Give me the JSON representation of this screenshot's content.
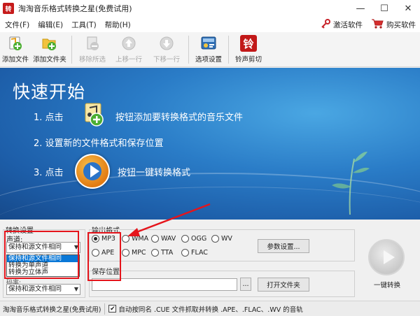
{
  "window": {
    "app_icon_text": "转",
    "title": "淘淘音乐格式转换之星(免费试用)",
    "controls": {
      "minimize": "—",
      "maximize": "☐",
      "close": "✕"
    }
  },
  "menu": {
    "items": [
      "文件(F)",
      "编辑(E)",
      "工具(T)",
      "帮助(H)"
    ],
    "activate": "激活软件",
    "buy": "购买软件"
  },
  "toolbar": {
    "buttons": [
      {
        "label": "添加文件",
        "icon": "add-file-icon",
        "enabled": true
      },
      {
        "label": "添加文件夹",
        "icon": "add-folder-icon",
        "enabled": true
      },
      {
        "label": "移除所选",
        "icon": "remove-icon",
        "enabled": false
      },
      {
        "label": "上移一行",
        "icon": "move-up-icon",
        "enabled": false
      },
      {
        "label": "下移一行",
        "icon": "move-down-icon",
        "enabled": false
      },
      {
        "label": "选项设置",
        "icon": "options-icon",
        "enabled": true
      },
      {
        "label": "铃声剪切",
        "icon": "ringtone-icon",
        "enabled": true
      }
    ],
    "ringtone_glyph": "铃"
  },
  "banner": {
    "title": "快速开始",
    "step1_prefix": "1. 点击",
    "step1_suffix": "按钮添加要转换格式的音乐文件",
    "step2": "2. 设置新的文件格式和保存位置",
    "step3_prefix": "3. 点击",
    "step3_suffix": "按钮一键转换格式"
  },
  "convert_settings": {
    "group_label": "转换设置",
    "channel_label": "声道:",
    "channel_value": "保持和源文件相同",
    "channel_options": [
      "保持和源文件相同",
      "转换为单声道",
      "转换为立体声"
    ],
    "second_label": "码率:",
    "second_value": "保持和源文件相同"
  },
  "output_format": {
    "group_label": "输出格式",
    "formats_row1": [
      "MP3",
      "WMA",
      "WAV",
      "OGG",
      "WV"
    ],
    "formats_row2": [
      "APE",
      "MPC",
      "TTA",
      "FLAC"
    ],
    "selected": "MP3",
    "params_button": "参数设置..."
  },
  "save_location": {
    "label": "保存位置",
    "path": "",
    "browse_button": "...",
    "open_folder_button": "打开文件夹"
  },
  "convert": {
    "label": "一键转换"
  },
  "status": {
    "app_name": "淘淘音乐格式转换之星(免费试用)",
    "checkbox_checked": true,
    "checkbox_text": "自动按同名 .CUE 文件抓取并转换 .APE、.FLAC、.WV 的音轨"
  },
  "colors": {
    "banner_blue": "#2a7cc7",
    "highlight_red": "#e5141b",
    "selection_blue": "#0a78d7",
    "disabled_gray": "#a9a9a9"
  }
}
